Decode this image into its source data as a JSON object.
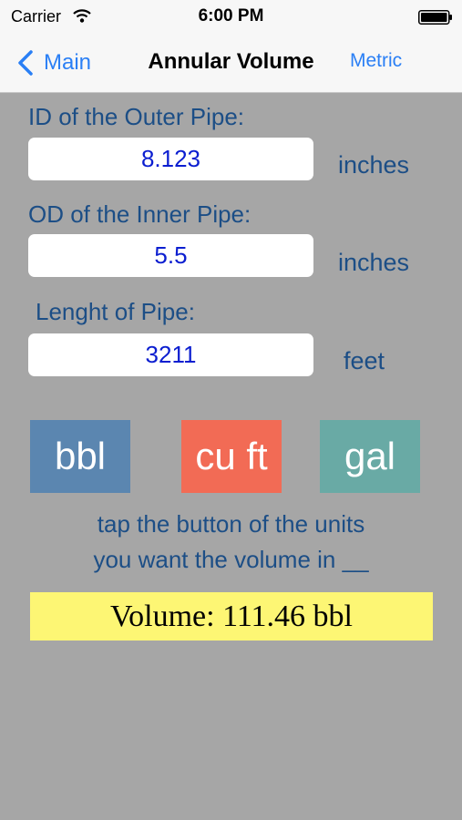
{
  "status_bar": {
    "carrier": "Carrier",
    "time": "6:00 PM",
    "wifi_icon": "wifi-icon",
    "battery_icon": "battery-icon"
  },
  "nav": {
    "back_label": "Main",
    "back_icon": "chevron-left-icon",
    "title": "Annular Volume",
    "right_button": "Metric"
  },
  "form": {
    "outer_pipe": {
      "label": "ID of the Outer Pipe:",
      "value": "8.123",
      "unit": "inches"
    },
    "inner_pipe": {
      "label": "OD of the Inner Pipe:",
      "value": "5.5",
      "unit": "inches"
    },
    "length": {
      "label": "Lenght of Pipe:",
      "value": "3211",
      "unit": "feet"
    }
  },
  "unit_buttons": [
    {
      "label": "bbl",
      "color": "#5b86b0"
    },
    {
      "label": "cu ft",
      "color": "#f26b55"
    },
    {
      "label": "gal",
      "color": "#69aaa5"
    }
  ],
  "hint": {
    "line1": "tap the button of the units",
    "line2": "you want the volume in __"
  },
  "result": {
    "text": "Volume: 111.46 bbl"
  },
  "colors": {
    "background": "#a6a6a6",
    "accent": "#2a7ff5",
    "label": "#1c4e86",
    "input_text": "#0b1ed0",
    "result_bg": "#fdf674"
  }
}
